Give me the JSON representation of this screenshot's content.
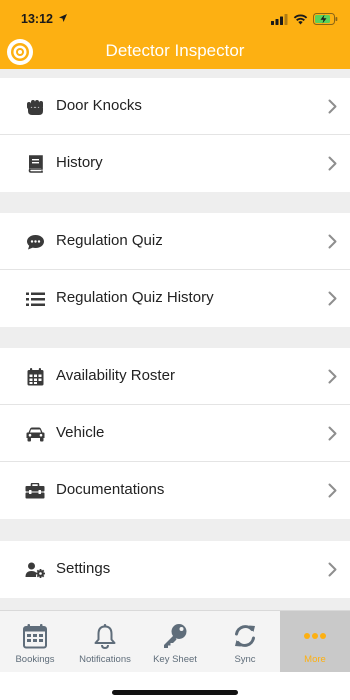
{
  "status_bar": {
    "time": "13:12"
  },
  "header": {
    "title": "Detector Inspector"
  },
  "menu_groups": [
    [
      {
        "label": "Door Knocks",
        "icon": "fist-icon"
      },
      {
        "label": "History",
        "icon": "book-icon"
      }
    ],
    [
      {
        "label": "Regulation Quiz",
        "icon": "chat-bubble-icon"
      },
      {
        "label": "Regulation Quiz History",
        "icon": "list-icon"
      }
    ],
    [
      {
        "label": "Availability Roster",
        "icon": "calendar-icon"
      },
      {
        "label": "Vehicle",
        "icon": "car-icon"
      },
      {
        "label": "Documentations",
        "icon": "toolbox-icon"
      }
    ],
    [
      {
        "label": "Settings",
        "icon": "user-cog-icon"
      }
    ]
  ],
  "tab_bar": {
    "tabs": [
      {
        "label": "Bookings",
        "icon": "calendar-icon"
      },
      {
        "label": "Notifications",
        "icon": "bell-icon"
      },
      {
        "label": "Key Sheet",
        "icon": "key-icon"
      },
      {
        "label": "Sync",
        "icon": "sync-icon"
      },
      {
        "label": "More",
        "icon": "more-dots-icon"
      }
    ],
    "active": "More"
  },
  "colors": {
    "brand_orange": "#fdb012",
    "icon_gray": "#5f6d7a",
    "background": "#eeeeee",
    "active_tab_bg": "#c9c9c9"
  }
}
